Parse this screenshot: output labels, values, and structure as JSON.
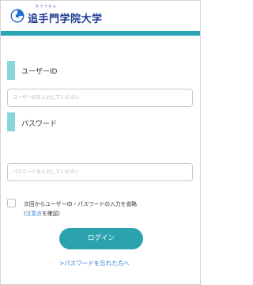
{
  "header": {
    "logo_text": "追手門学院大学",
    "logo_ruby": "おうてもん",
    "accent_color": "#2aa5b5"
  },
  "userid": {
    "label": "ユーザーID",
    "placeholder": "ユーザーIDを入力してください"
  },
  "password": {
    "label": "パスワード",
    "placeholder": "パスワードを入力してください"
  },
  "remember": {
    "line1": "次回からユーザーID・パスワードの入力を省略",
    "line2_open": "(",
    "line2_link": "注意点",
    "line2_close": "を確認)"
  },
  "login_button": "ログイン",
  "forgot_link": ">パスワードを忘れた方へ"
}
